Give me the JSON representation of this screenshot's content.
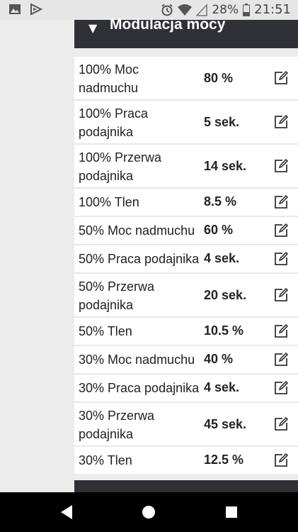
{
  "status_bar": {
    "icons_left": [
      "image-icon",
      "play-store-icon"
    ],
    "icons_right": [
      "alarm-icon",
      "wifi-icon",
      "signal-icon"
    ],
    "battery": "28%",
    "time": "21:51"
  },
  "section": {
    "title": "Modulacja mocy",
    "expanded": true
  },
  "rows": [
    {
      "label": "100% Moc nadmuchu",
      "value": "80 %"
    },
    {
      "label": "100% Praca podajnika",
      "value": "5 sek."
    },
    {
      "label": "100% Przerwa podajnika",
      "value": "14 sek."
    },
    {
      "label": "100% Tlen",
      "value": "8.5 %"
    },
    {
      "label": "50% Moc nadmuchu",
      "value": "60 %"
    },
    {
      "label": "50% Praca podajnika",
      "value": "4 sek."
    },
    {
      "label": "50% Przerwa podajnika",
      "value": "20 sek."
    },
    {
      "label": "50% Tlen",
      "value": "10.5 %"
    },
    {
      "label": "30% Moc nadmuchu",
      "value": "40 %"
    },
    {
      "label": "30% Praca podajnika",
      "value": "4 sek."
    },
    {
      "label": "30% Przerwa podajnika",
      "value": "45 sek."
    },
    {
      "label": "30% Tlen",
      "value": "12.5 %"
    }
  ],
  "nav": [
    "back-icon",
    "home-icon",
    "recents-icon"
  ]
}
